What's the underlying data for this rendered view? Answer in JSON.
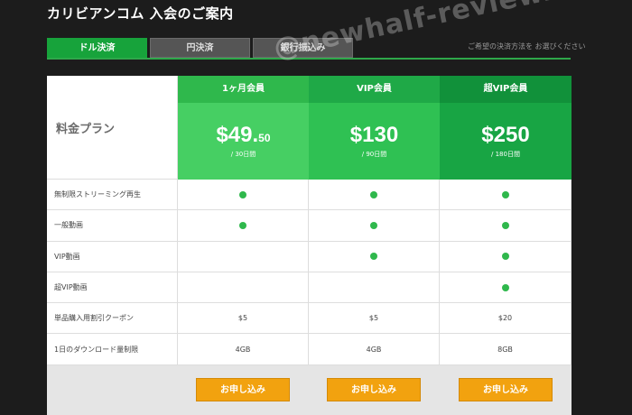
{
  "page": {
    "title": "カリビアンコム 入会のご案内"
  },
  "watermark": "@newhalf-review.info",
  "tabs": [
    {
      "label": "ドル決済",
      "active": true
    },
    {
      "label": "円決済",
      "active": false
    },
    {
      "label": "銀行振込み",
      "active": false
    }
  ],
  "tab_note": "ご希望の決済方法を お選びください",
  "plan_label": "料金プラン",
  "plans": [
    {
      "name": "1ヶ月会員",
      "price_main": "$49.",
      "price_cents": "50",
      "period": "/ 30日間",
      "color": "#46cf63"
    },
    {
      "name": "VIP会員",
      "price_main": "$130",
      "price_cents": "",
      "period": "/ 90日間",
      "color": "#2fc153"
    },
    {
      "name": "超VIP会員",
      "price_main": "$250",
      "price_cents": "",
      "period": "/ 180日間",
      "color": "#18a544"
    }
  ],
  "features": [
    {
      "label": "無制限ストリーミング再生",
      "values": [
        "dot",
        "dot",
        "dot"
      ]
    },
    {
      "label": "一般動画",
      "values": [
        "dot",
        "dot",
        "dot"
      ]
    },
    {
      "label": "VIP動画",
      "values": [
        "",
        "dot",
        "dot"
      ]
    },
    {
      "label": "超VIP動画",
      "values": [
        "",
        "",
        "dot"
      ]
    },
    {
      "label": "単品購入用割引クーポン",
      "values": [
        "$5",
        "$5",
        "$20"
      ]
    },
    {
      "label": "1日のダウンロード量制限",
      "values": [
        "4GB",
        "4GB",
        "8GB"
      ]
    }
  ],
  "apply_label": "お申し込み"
}
